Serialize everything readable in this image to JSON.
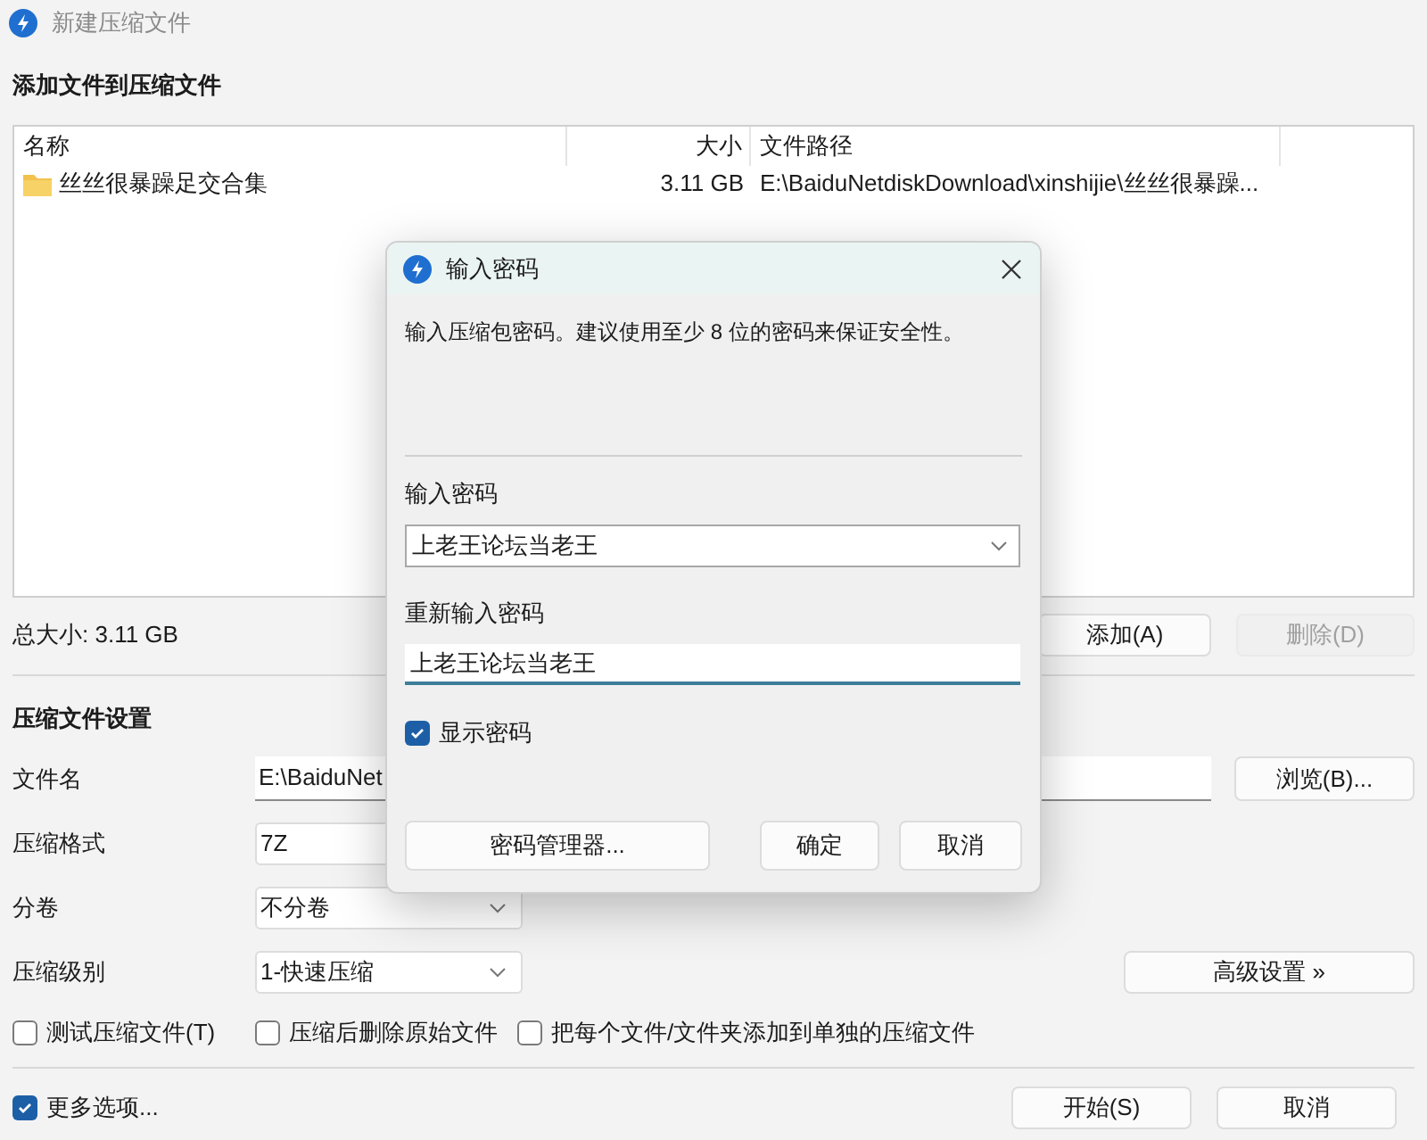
{
  "window": {
    "title": "新建压缩文件"
  },
  "files_section": {
    "title": "添加文件到压缩文件",
    "columns": [
      "名称",
      "大小",
      "文件路径"
    ],
    "rows": [
      {
        "name": "丝丝很暴躁足交合集",
        "size": "3.11 GB",
        "path": "E:\\BaiduNetdiskDownload\\xinshijie\\丝丝很暴躁..."
      }
    ],
    "total": "总大小: 3.11 GB",
    "buttons": [
      {
        "label": "添加(A)",
        "disabled": false
      },
      {
        "label": "删除(D)",
        "disabled": true
      }
    ]
  },
  "settings": {
    "title": "压缩文件设置",
    "filename": {
      "label": "文件名",
      "value": "E:\\BaiduNet",
      "browse": "浏览(B)..."
    },
    "format": {
      "label": "压缩格式",
      "value": "7Z"
    },
    "volume": {
      "label": "分卷",
      "value": "不分卷"
    },
    "level": {
      "label": "压缩级别",
      "value": "1-快速压缩"
    },
    "advanced": "高级设置 »",
    "options": [
      {
        "label": "测试压缩文件(T)",
        "checked": false
      },
      {
        "label": "压缩后删除原始文件",
        "checked": false
      },
      {
        "label": "把每个文件/文件夹添加到单独的压缩文件",
        "checked": false
      }
    ]
  },
  "footer": {
    "more": {
      "label": "更多选项...",
      "checked": true
    },
    "buttons": [
      "开始(S)",
      "取消"
    ]
  },
  "dialog": {
    "title": "输入密码",
    "description": "输入压缩包密码。建议使用至少 8 位的密码来保证安全性。",
    "password": {
      "label": "输入密码",
      "value": "上老王论坛当老王"
    },
    "confirm": {
      "label": "重新输入密码",
      "value": "上老王论坛当老王"
    },
    "show_password": {
      "label": "显示密码",
      "checked": true
    },
    "manager": "密码管理器...",
    "buttons": [
      "确定",
      "取消"
    ]
  }
}
